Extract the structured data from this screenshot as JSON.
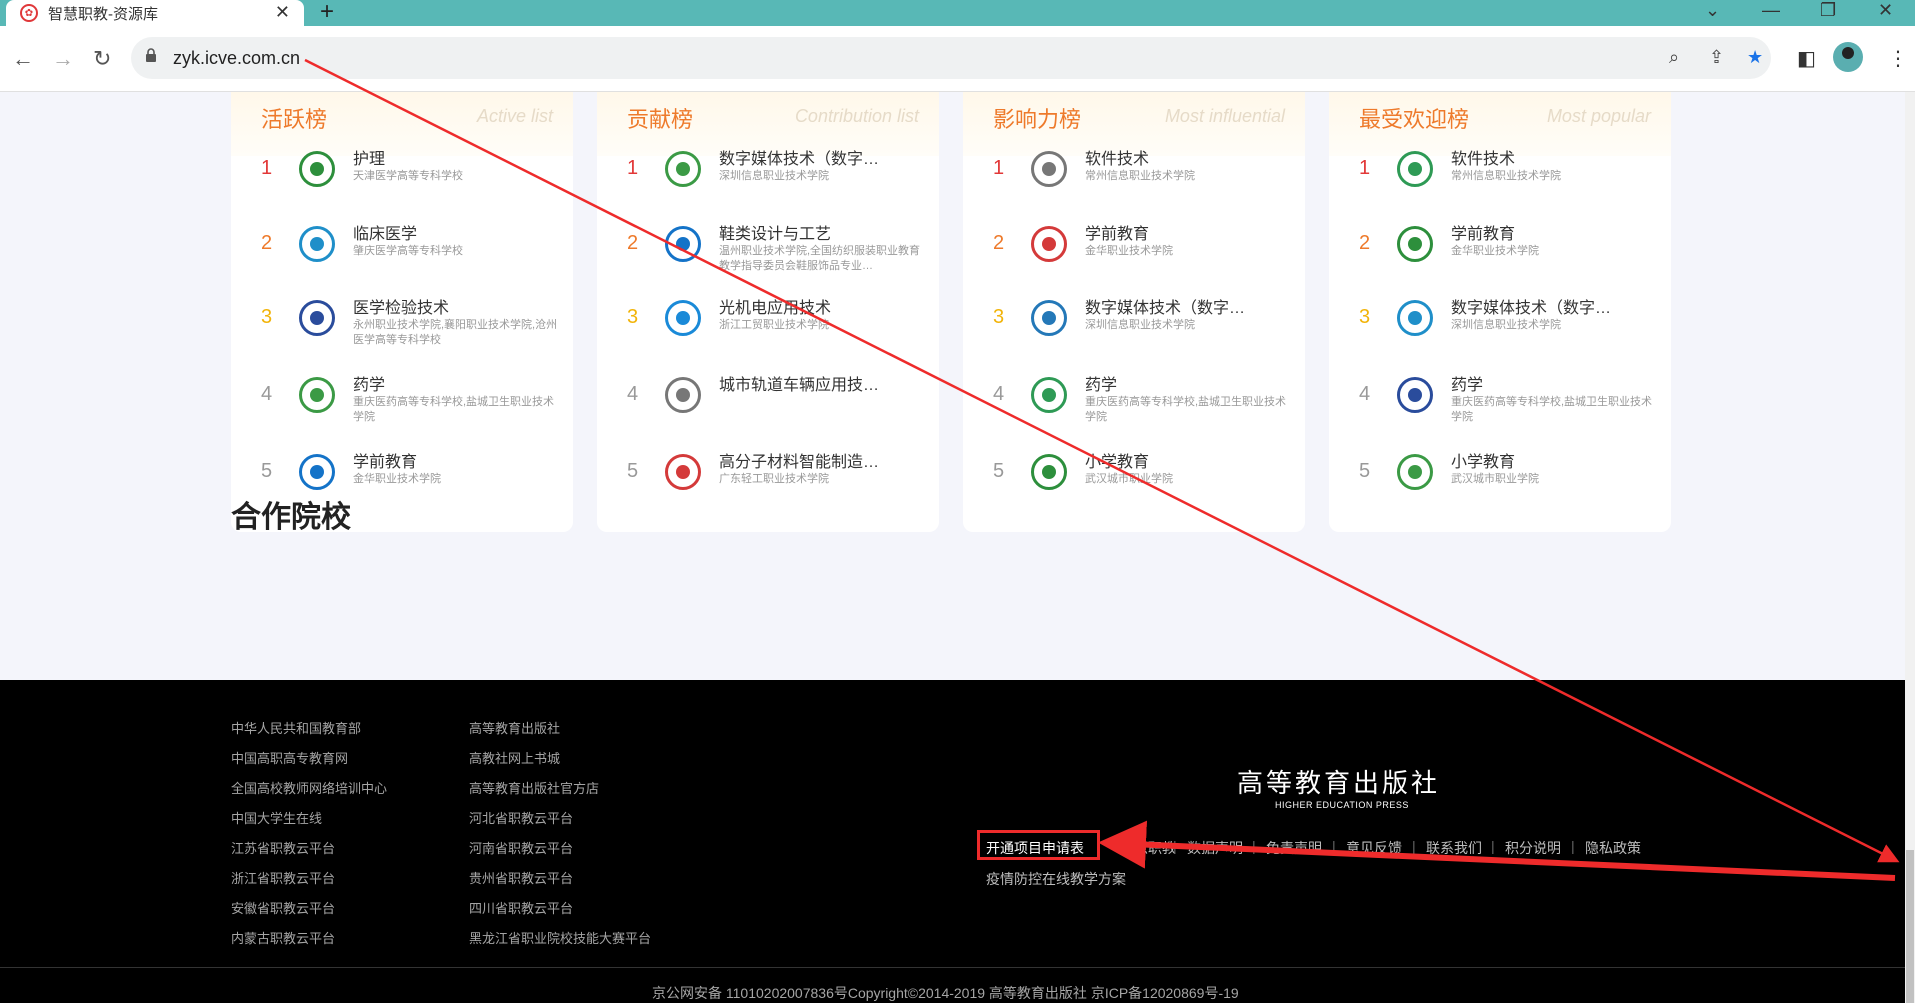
{
  "browser": {
    "tab_title": "智慧职教-资源库",
    "url": "zyk.icve.com.cn"
  },
  "cards": [
    {
      "title": "活跃榜",
      "title_en": "Active list",
      "items": [
        {
          "rank": "1",
          "name": "护理",
          "sub": "天津医学高等专科学校"
        },
        {
          "rank": "2",
          "name": "临床医学",
          "sub": "肇庆医学高等专科学校"
        },
        {
          "rank": "3",
          "name": "医学检验技术",
          "sub": "永州职业技术学院,襄阳职业技术学院,沧州医学高等专科学校"
        },
        {
          "rank": "4",
          "name": "药学",
          "sub": "重庆医药高等专科学校,盐城卫生职业技术学院"
        },
        {
          "rank": "5",
          "name": "学前教育",
          "sub": "金华职业技术学院"
        }
      ]
    },
    {
      "title": "贡献榜",
      "title_en": "Contribution list",
      "items": [
        {
          "rank": "1",
          "name": "数字媒体技术（数字…",
          "sub": "深圳信息职业技术学院"
        },
        {
          "rank": "2",
          "name": "鞋类设计与工艺",
          "sub": "温州职业技术学院,全国纺织服装职业教育教学指导委员会鞋服饰品专业…"
        },
        {
          "rank": "3",
          "name": "光机电应用技术",
          "sub": "浙江工贸职业技术学院"
        },
        {
          "rank": "4",
          "name": "城市轨道车辆应用技…",
          "sub": ""
        },
        {
          "rank": "5",
          "name": "高分子材料智能制造…",
          "sub": "广东轻工职业技术学院"
        }
      ]
    },
    {
      "title": "影响力榜",
      "title_en": "Most influential",
      "items": [
        {
          "rank": "1",
          "name": "软件技术",
          "sub": "常州信息职业技术学院"
        },
        {
          "rank": "2",
          "name": "学前教育",
          "sub": "金华职业技术学院"
        },
        {
          "rank": "3",
          "name": "数字媒体技术（数字…",
          "sub": "深圳信息职业技术学院"
        },
        {
          "rank": "4",
          "name": "药学",
          "sub": "重庆医药高等专科学校,盐城卫生职业技术学院"
        },
        {
          "rank": "5",
          "name": "小学教育",
          "sub": "武汉城市职业学院"
        }
      ]
    },
    {
      "title": "最受欢迎榜",
      "title_en": "Most popular",
      "items": [
        {
          "rank": "1",
          "name": "软件技术",
          "sub": "常州信息职业技术学院"
        },
        {
          "rank": "2",
          "name": "学前教育",
          "sub": "金华职业技术学院"
        },
        {
          "rank": "3",
          "name": "数字媒体技术（数字…",
          "sub": "深圳信息职业技术学院"
        },
        {
          "rank": "4",
          "name": "药学",
          "sub": "重庆医药高等专科学校,盐城卫生职业技术学院"
        },
        {
          "rank": "5",
          "name": "小学教育",
          "sub": "武汉城市职业学院"
        }
      ]
    }
  ],
  "section_title": "合作院校",
  "footer": {
    "links_col1": [
      "中华人民共和国教育部",
      "中国高职高专教育网",
      "全国高校教师网络培训中心",
      "中国大学生在线",
      "江苏省职教云平台",
      "浙江省职教云平台",
      "安徽省职教云平台",
      "内蒙古职教云平台"
    ],
    "links_col2": [
      "高等教育出版社",
      "高教社网上书城",
      "高等教育出版社官方店",
      "河北省职教云平台",
      "河南省职教云平台",
      "贵州省职教云平台",
      "四川省职教云平台",
      "黑龙江省职业院校技能大赛平台"
    ],
    "publisher_cn": "高等教育出版社",
    "publisher_en": "HIGHER EDUCATION PRESS",
    "menu": [
      "开通项目申请表",
      "智慧职教",
      "数据声明",
      "免责声明",
      "意见反馈",
      "联系我们",
      "积分说明",
      "隐私政策"
    ],
    "menu2": "疫情防控在线教学方案",
    "copyright": "京公网安备 11010202007836号Copyright©2014-2019 高等教育出版社  京ICP备12020869号-19"
  },
  "colors": {
    "accent": "#ee7a2b",
    "annotation": "#ee2b2b",
    "tabbar": "#58b8b6"
  }
}
